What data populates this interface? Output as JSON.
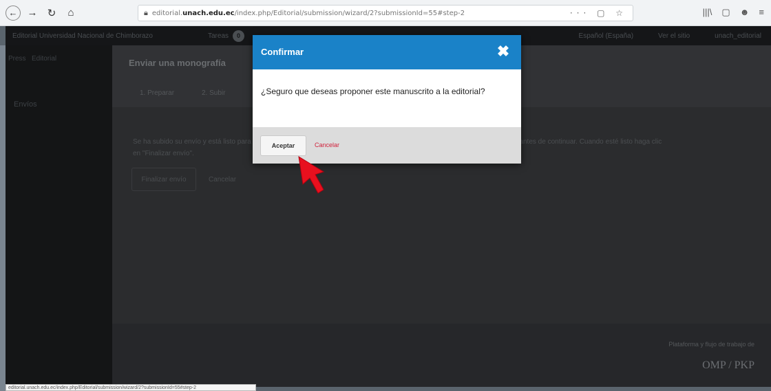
{
  "browser": {
    "back_glyph": "←",
    "forward_glyph": "→",
    "reload_glyph": "↻",
    "home_glyph": "⌂",
    "url_prefix": "editorial.",
    "url_domain": "unach.edu.ec",
    "url_path": "/index.php/Editorial/submission/wizard/2?submissionId=55#step-2",
    "url_tools": "··· ▢ ☆",
    "right_icons": [
      "|||\\",
      "▢",
      "☻",
      "≡"
    ]
  },
  "app_header": {
    "brand": "Editorial Universidad Nacional de Chimborazo",
    "tasks_label": "Tareas",
    "tasks_count": "0",
    "right_items": [
      "Español (España)",
      "Ver el sitio",
      "unach_editorial"
    ]
  },
  "sidebar": {
    "press_left": "Press",
    "press_mid": "Editorial",
    "press_right": "",
    "items": [
      "Envíos"
    ]
  },
  "main": {
    "page_title": "Enviar una monografía",
    "tabs": [
      "1. Preparar",
      "2. Subir"
    ],
    "body_line1": "Se ha subido su envío y está listo para ser enviado. Puede volver atrás para revisar y ajustar cualquier información que desee antes de continuar. Cuando esté listo haga clic",
    "body_line2": "en \"Finalizar envío\".",
    "finish_label": "Finalizar envío",
    "cancel_label": "Cancelar",
    "footer_powered": "Plataforma y flujo de trabajo de",
    "footer_brand": "OMP / PKP"
  },
  "statusbar": {
    "text": "editorial.unach.edu.ec/index.php/Editorial/submission/wizard/2?submissionId=55#step-2"
  },
  "modal": {
    "title": "Confirmar",
    "close_glyph": "✖",
    "message": "¿Seguro que deseas proponer este manuscrito a la editorial?",
    "accept_label": "Aceptar",
    "cancel_label": "Cancelar"
  },
  "colors": {
    "modal_header": "#1a82c8",
    "cancel_link": "#d0213b",
    "annotation_arrow": "#e8101e"
  }
}
